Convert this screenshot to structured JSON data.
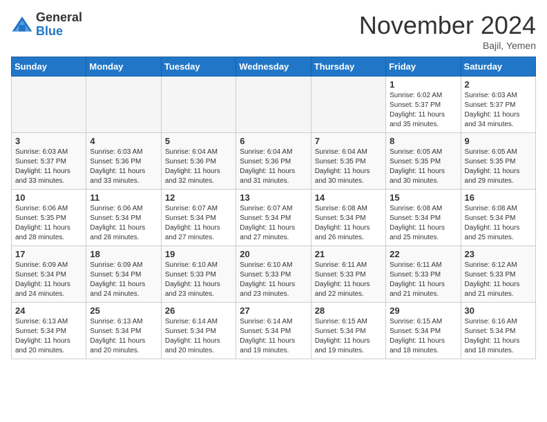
{
  "logo": {
    "general": "General",
    "blue": "Blue"
  },
  "header": {
    "month": "November 2024",
    "location": "Bajil, Yemen"
  },
  "weekdays": [
    "Sunday",
    "Monday",
    "Tuesday",
    "Wednesday",
    "Thursday",
    "Friday",
    "Saturday"
  ],
  "weeks": [
    [
      {
        "day": "",
        "info": ""
      },
      {
        "day": "",
        "info": ""
      },
      {
        "day": "",
        "info": ""
      },
      {
        "day": "",
        "info": ""
      },
      {
        "day": "",
        "info": ""
      },
      {
        "day": "1",
        "info": "Sunrise: 6:02 AM\nSunset: 5:37 PM\nDaylight: 11 hours\nand 35 minutes."
      },
      {
        "day": "2",
        "info": "Sunrise: 6:03 AM\nSunset: 5:37 PM\nDaylight: 11 hours\nand 34 minutes."
      }
    ],
    [
      {
        "day": "3",
        "info": "Sunrise: 6:03 AM\nSunset: 5:37 PM\nDaylight: 11 hours\nand 33 minutes."
      },
      {
        "day": "4",
        "info": "Sunrise: 6:03 AM\nSunset: 5:36 PM\nDaylight: 11 hours\nand 33 minutes."
      },
      {
        "day": "5",
        "info": "Sunrise: 6:04 AM\nSunset: 5:36 PM\nDaylight: 11 hours\nand 32 minutes."
      },
      {
        "day": "6",
        "info": "Sunrise: 6:04 AM\nSunset: 5:36 PM\nDaylight: 11 hours\nand 31 minutes."
      },
      {
        "day": "7",
        "info": "Sunrise: 6:04 AM\nSunset: 5:35 PM\nDaylight: 11 hours\nand 30 minutes."
      },
      {
        "day": "8",
        "info": "Sunrise: 6:05 AM\nSunset: 5:35 PM\nDaylight: 11 hours\nand 30 minutes."
      },
      {
        "day": "9",
        "info": "Sunrise: 6:05 AM\nSunset: 5:35 PM\nDaylight: 11 hours\nand 29 minutes."
      }
    ],
    [
      {
        "day": "10",
        "info": "Sunrise: 6:06 AM\nSunset: 5:35 PM\nDaylight: 11 hours\nand 28 minutes."
      },
      {
        "day": "11",
        "info": "Sunrise: 6:06 AM\nSunset: 5:34 PM\nDaylight: 11 hours\nand 28 minutes."
      },
      {
        "day": "12",
        "info": "Sunrise: 6:07 AM\nSunset: 5:34 PM\nDaylight: 11 hours\nand 27 minutes."
      },
      {
        "day": "13",
        "info": "Sunrise: 6:07 AM\nSunset: 5:34 PM\nDaylight: 11 hours\nand 27 minutes."
      },
      {
        "day": "14",
        "info": "Sunrise: 6:08 AM\nSunset: 5:34 PM\nDaylight: 11 hours\nand 26 minutes."
      },
      {
        "day": "15",
        "info": "Sunrise: 6:08 AM\nSunset: 5:34 PM\nDaylight: 11 hours\nand 25 minutes."
      },
      {
        "day": "16",
        "info": "Sunrise: 6:08 AM\nSunset: 5:34 PM\nDaylight: 11 hours\nand 25 minutes."
      }
    ],
    [
      {
        "day": "17",
        "info": "Sunrise: 6:09 AM\nSunset: 5:34 PM\nDaylight: 11 hours\nand 24 minutes."
      },
      {
        "day": "18",
        "info": "Sunrise: 6:09 AM\nSunset: 5:34 PM\nDaylight: 11 hours\nand 24 minutes."
      },
      {
        "day": "19",
        "info": "Sunrise: 6:10 AM\nSunset: 5:33 PM\nDaylight: 11 hours\nand 23 minutes."
      },
      {
        "day": "20",
        "info": "Sunrise: 6:10 AM\nSunset: 5:33 PM\nDaylight: 11 hours\nand 23 minutes."
      },
      {
        "day": "21",
        "info": "Sunrise: 6:11 AM\nSunset: 5:33 PM\nDaylight: 11 hours\nand 22 minutes."
      },
      {
        "day": "22",
        "info": "Sunrise: 6:11 AM\nSunset: 5:33 PM\nDaylight: 11 hours\nand 21 minutes."
      },
      {
        "day": "23",
        "info": "Sunrise: 6:12 AM\nSunset: 5:33 PM\nDaylight: 11 hours\nand 21 minutes."
      }
    ],
    [
      {
        "day": "24",
        "info": "Sunrise: 6:13 AM\nSunset: 5:34 PM\nDaylight: 11 hours\nand 20 minutes."
      },
      {
        "day": "25",
        "info": "Sunrise: 6:13 AM\nSunset: 5:34 PM\nDaylight: 11 hours\nand 20 minutes."
      },
      {
        "day": "26",
        "info": "Sunrise: 6:14 AM\nSunset: 5:34 PM\nDaylight: 11 hours\nand 20 minutes."
      },
      {
        "day": "27",
        "info": "Sunrise: 6:14 AM\nSunset: 5:34 PM\nDaylight: 11 hours\nand 19 minutes."
      },
      {
        "day": "28",
        "info": "Sunrise: 6:15 AM\nSunset: 5:34 PM\nDaylight: 11 hours\nand 19 minutes."
      },
      {
        "day": "29",
        "info": "Sunrise: 6:15 AM\nSunset: 5:34 PM\nDaylight: 11 hours\nand 18 minutes."
      },
      {
        "day": "30",
        "info": "Sunrise: 6:16 AM\nSunset: 5:34 PM\nDaylight: 11 hours\nand 18 minutes."
      }
    ]
  ]
}
